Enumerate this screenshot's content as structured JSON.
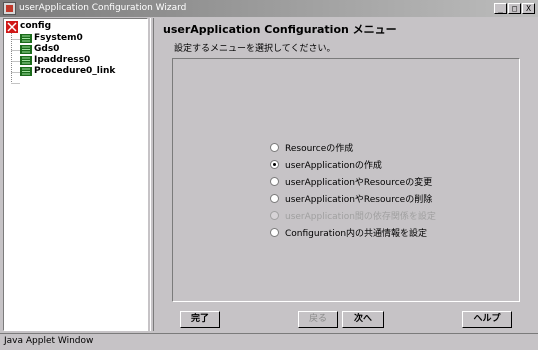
{
  "window": {
    "title": "userApplication Configuration Wizard",
    "controls": [
      "_",
      "□",
      "X"
    ]
  },
  "tree": {
    "root": "config",
    "items": [
      "Fsystem0",
      "Gds0",
      "Ipaddress0",
      "Procedure0_link"
    ]
  },
  "main": {
    "heading": "userApplication Configuration メニュー",
    "instruction": "設定するメニューを選択してください。"
  },
  "options": [
    {
      "label": "Resourceの作成",
      "selected": false,
      "enabled": true
    },
    {
      "label": "userApplicationの作成",
      "selected": true,
      "enabled": true
    },
    {
      "label": "userApplicationやResourceの変更",
      "selected": false,
      "enabled": true
    },
    {
      "label": "userApplicationやResourceの削除",
      "selected": false,
      "enabled": true
    },
    {
      "label": "userApplication間の依存関係を設定",
      "selected": false,
      "enabled": false
    },
    {
      "label": "Configuration内の共通情報を設定",
      "selected": false,
      "enabled": true
    }
  ],
  "buttons": {
    "finish": "完了",
    "back": "戻る",
    "next": "次へ",
    "help": "ヘルプ"
  },
  "status": "Java Applet Window"
}
